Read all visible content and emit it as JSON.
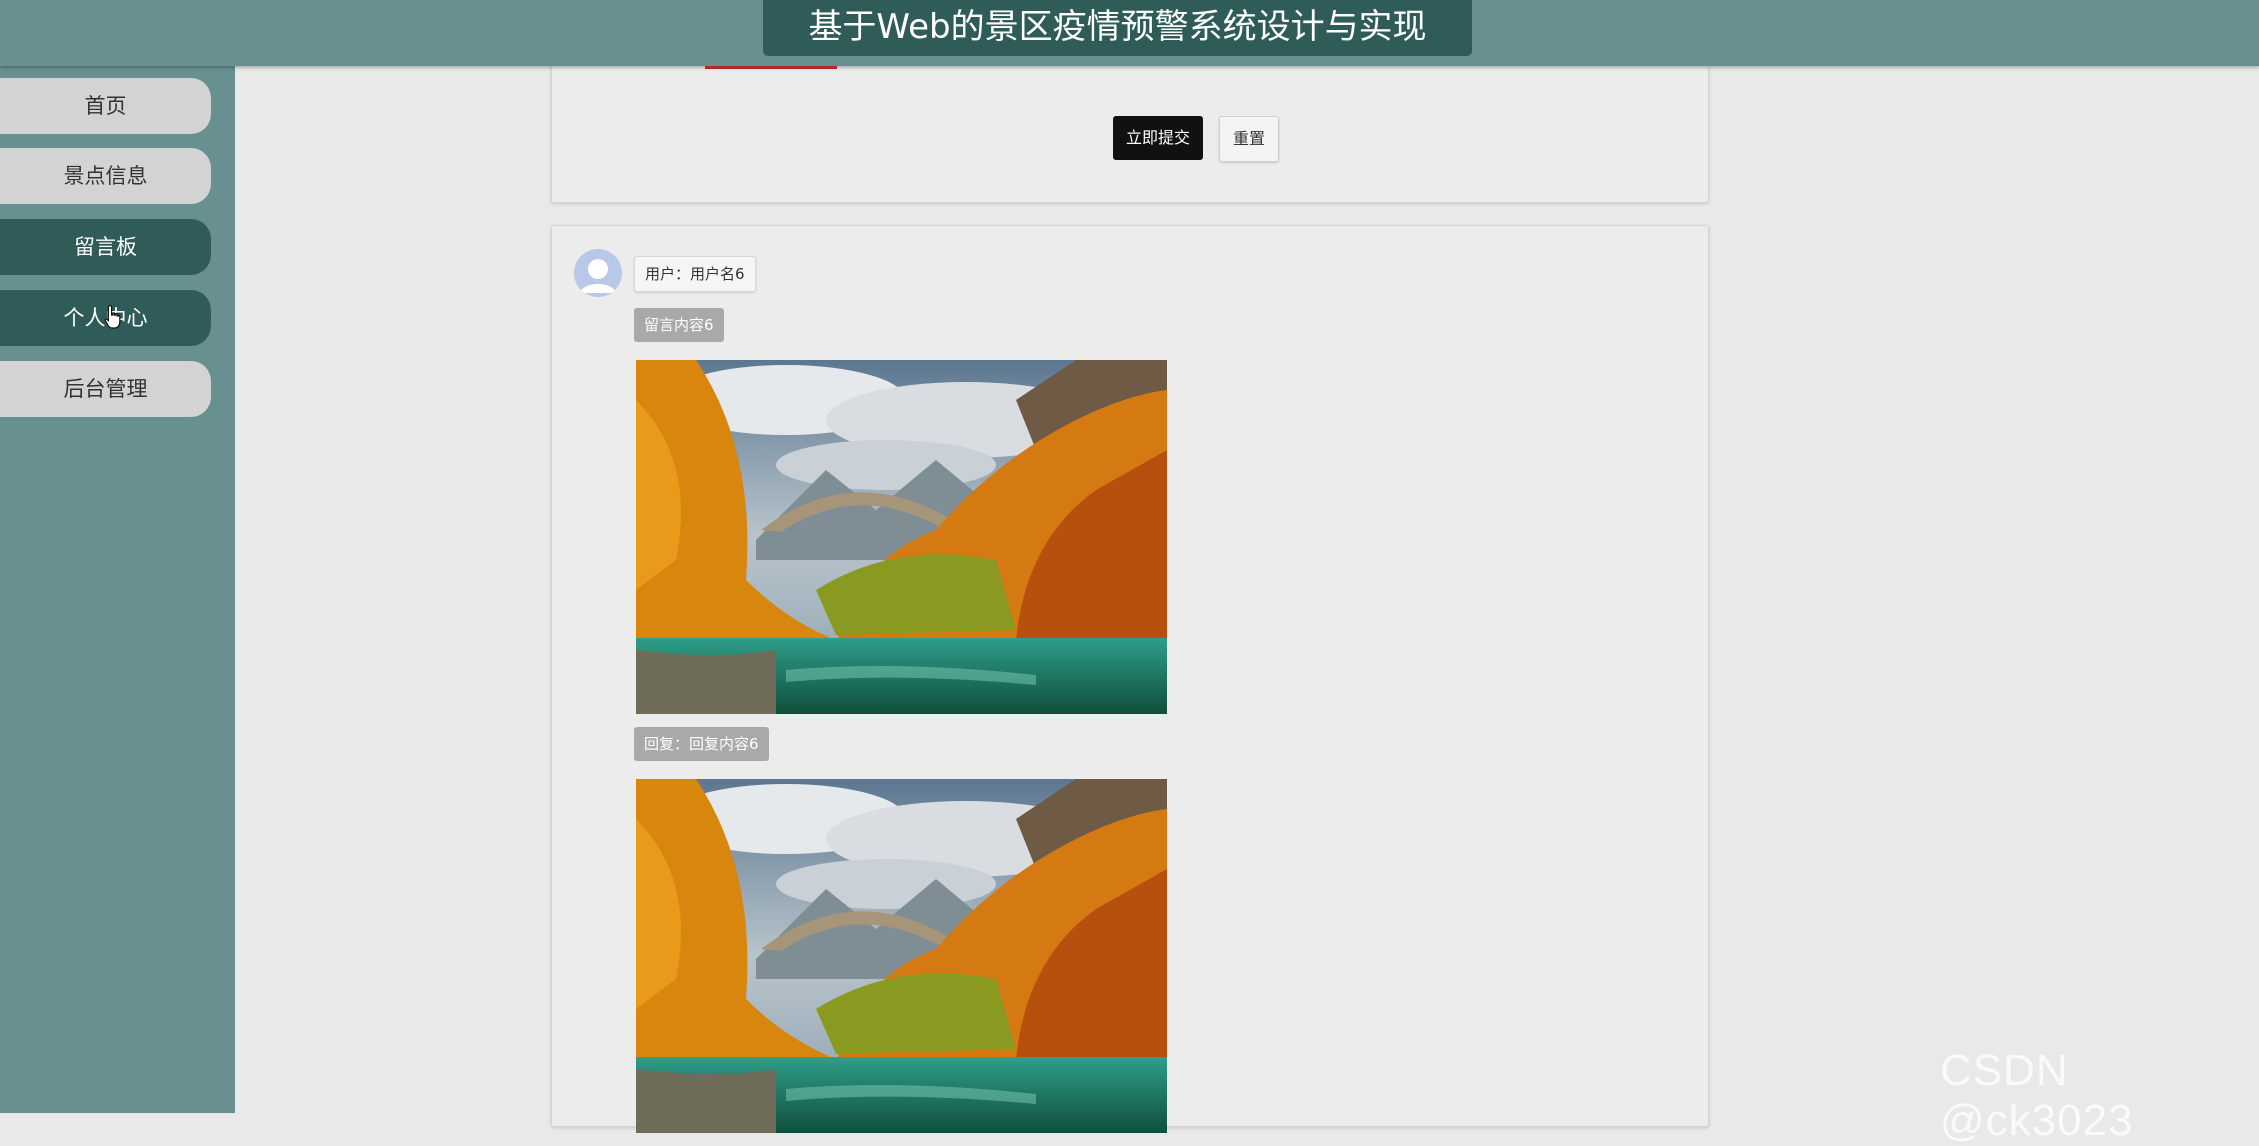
{
  "header": {
    "title": "基于Web的景区疫情预警系统设计与实现"
  },
  "sidebar": {
    "items": [
      {
        "label": "首页"
      },
      {
        "label": "景点信息"
      },
      {
        "label": "留言板"
      },
      {
        "label": "个人中心"
      },
      {
        "label": "后台管理"
      }
    ]
  },
  "form": {
    "submit_label": "立即提交",
    "reset_label": "重置"
  },
  "message": {
    "user_text": "用户：用户名6",
    "content_text": "留言内容6",
    "reply_text": "回复：回复内容6"
  },
  "watermark": "CSDN @ck3023",
  "colors": {
    "header_bg": "#689090",
    "title_bg": "#2f5c59",
    "active_nav": "#2f5c59",
    "inactive_nav": "#d3d3d3",
    "page_bg": "#e9e9e9"
  }
}
